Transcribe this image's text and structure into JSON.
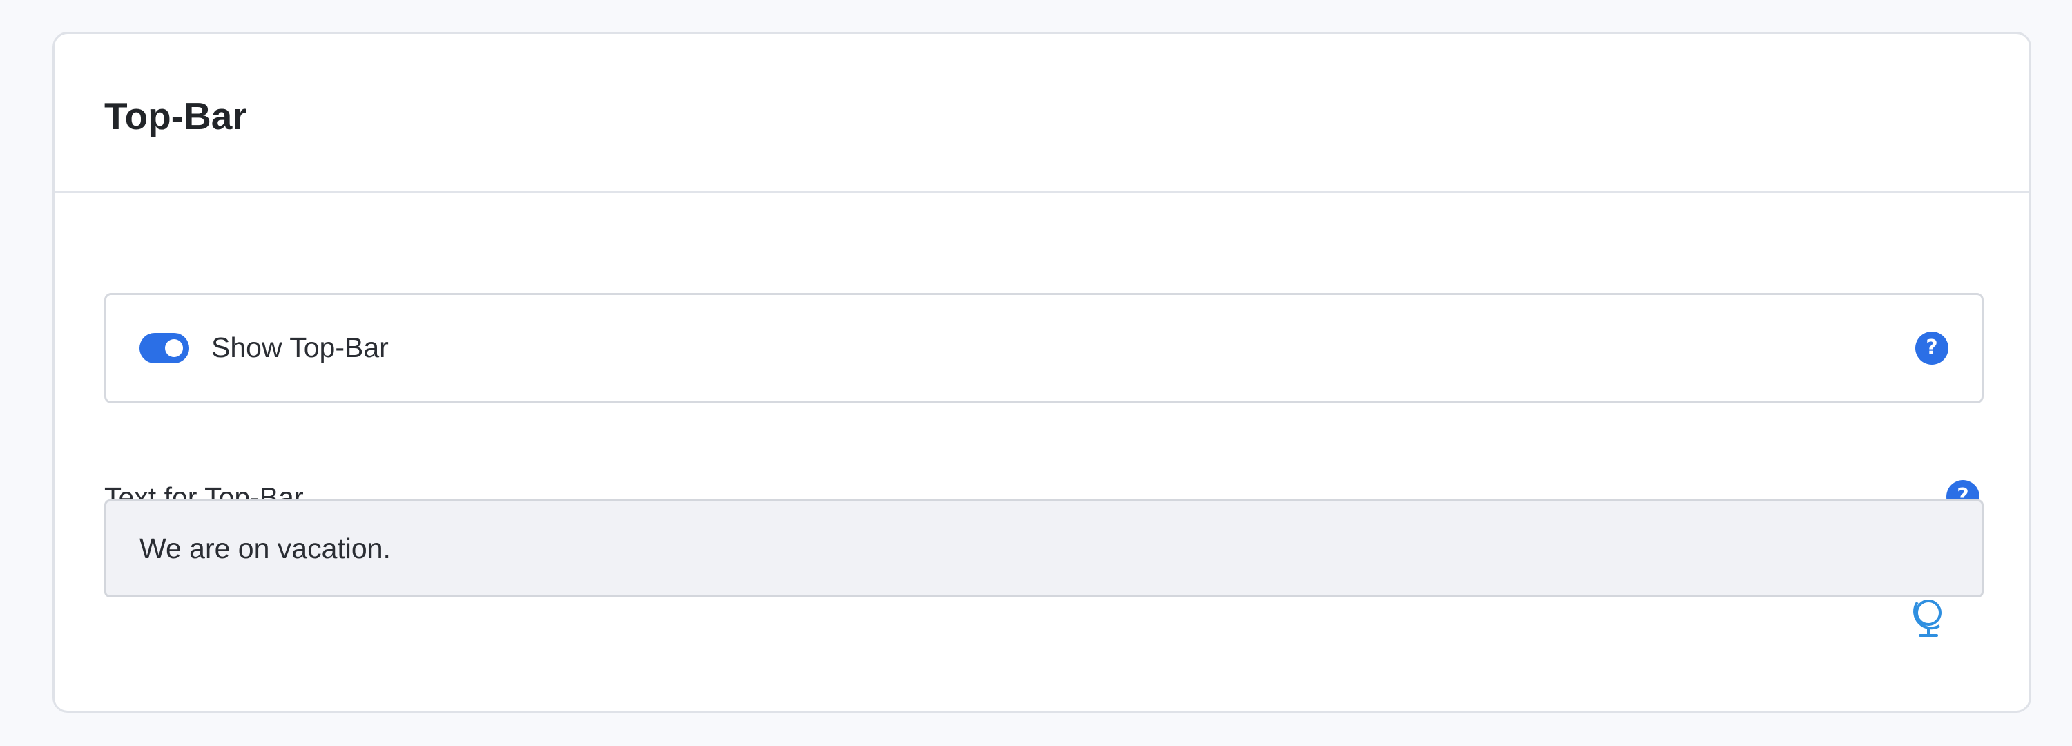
{
  "card": {
    "title": "Top-Bar"
  },
  "toggle": {
    "label": "Show Top-Bar",
    "checked": true,
    "help_icon": "question-icon"
  },
  "text_field": {
    "label": "Text for Top-Bar",
    "value": "We are on vacation.",
    "help_icon": "question-icon",
    "translate_icon": "globe-icon"
  },
  "colors": {
    "accent": "#2b6fe6",
    "globe": "#2f8fe0",
    "input_bg": "#f1f2f6",
    "page_bg": "#f8f9fc"
  }
}
